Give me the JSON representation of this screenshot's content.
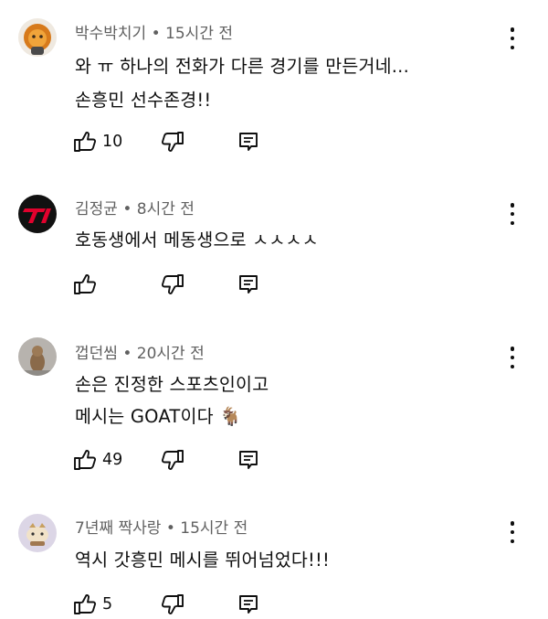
{
  "comments": [
    {
      "author": "박수박치기",
      "time": "15시간 전",
      "lines": [
        "와 ㅠ 하나의 전화가 다른 경기를 만든거네...",
        "손흥민 선수존경!!"
      ],
      "likes": "10",
      "avatar_icon": "lion-character-avatar"
    },
    {
      "author": "김정균",
      "time": "8시간 전",
      "lines": [
        "호동생에서 메동생으로 ㅅㅅㅅㅅ"
      ],
      "likes": "",
      "avatar_icon": "t1-logo-avatar"
    },
    {
      "author": "껍던씸",
      "time": "20시간 전",
      "lines": [
        "손은 진정한 스포츠인이고",
        "메시는 GOAT이다 🐐"
      ],
      "likes": "49",
      "avatar_icon": "dog-photo-avatar"
    },
    {
      "author": "7년째 짝사랑",
      "time": "15시간 전",
      "lines": [
        "역시 갓흥민 메시를 뛰어넘었다!!!"
      ],
      "likes": "5",
      "avatar_icon": "cartoon-avatar"
    }
  ],
  "separator": "•",
  "icons": {
    "like": "thumbs-up-icon",
    "dislike": "thumbs-down-icon",
    "reply": "reply-icon",
    "more": "more-vert-icon"
  },
  "colors": {
    "text": "#0f0f0f",
    "secondary": "#606060",
    "avatar_bg_3": "#b7b3ae"
  }
}
